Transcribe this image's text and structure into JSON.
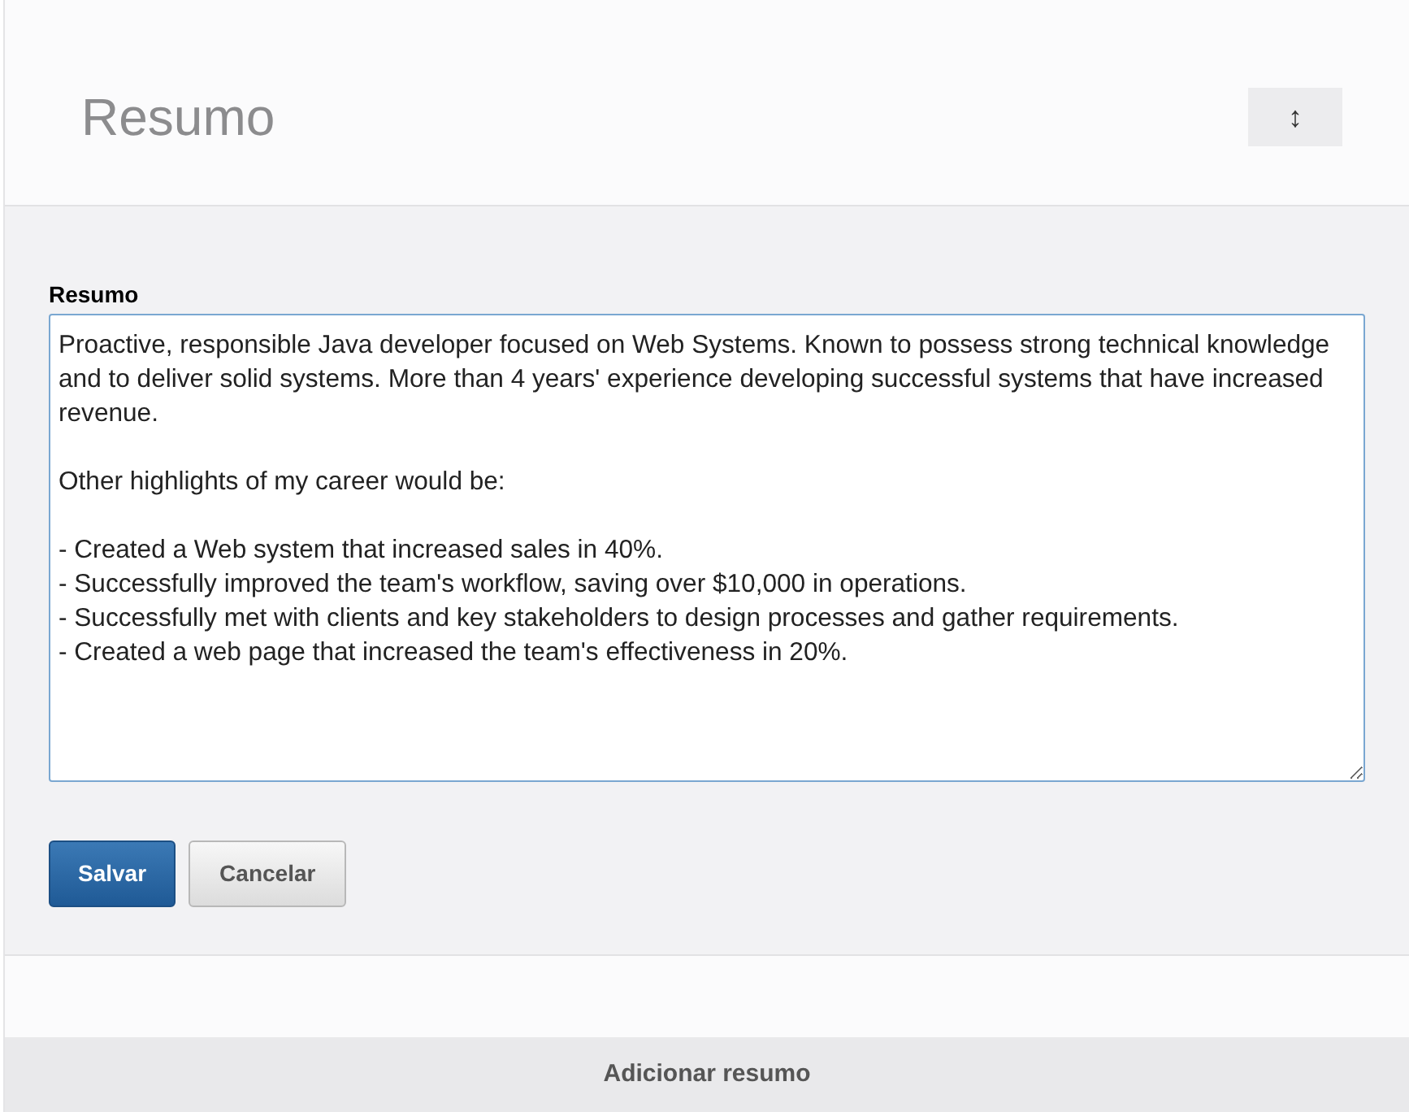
{
  "header": {
    "title": "Resumo",
    "toggle_icon": "↕"
  },
  "form": {
    "label": "Resumo",
    "value": "Proactive, responsible Java developer focused on Web Systems. Known to possess strong technical knowledge and to deliver solid systems. More than 4 years' experience developing successful systems that have increased revenue.\n\nOther highlights of my career would be:\n\n- Created a Web system that increased sales in 40%.\n- Successfully improved the team's workflow, saving over $10,000 in operations.\n- Successfully met with clients and key stakeholders to design processes and gather requirements.\n- Created a web page that increased the team's effectiveness in 20%.",
    "buttons": [
      {
        "label": "Salvar",
        "kind": "primary"
      },
      {
        "label": "Cancelar",
        "kind": "secondary"
      }
    ]
  },
  "footer": {
    "label": "Adicionar resumo"
  }
}
